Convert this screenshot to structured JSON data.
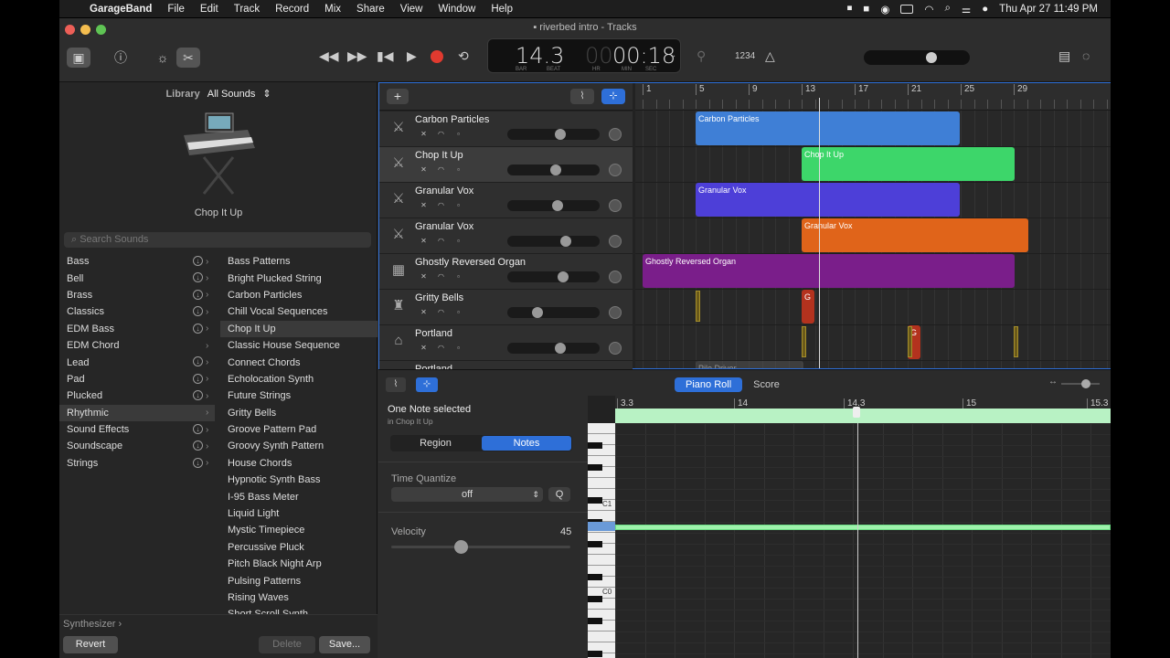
{
  "menubar": {
    "app": "GarageBand",
    "items": [
      "File",
      "Edit",
      "Track",
      "Record",
      "Mix",
      "Share",
      "View",
      "Window",
      "Help"
    ],
    "clock": "Thu Apr 27  11:49 PM"
  },
  "window": {
    "title": "riverbed intro - Tracks"
  },
  "lcd": {
    "bar_beat": "14.3",
    "bar_label": "BAR",
    "beat_label": "BEAT",
    "time_dim": "00",
    "time": "00:18",
    "hr_label": "HR",
    "min_label": "MIN",
    "sec_label": "SEC",
    "count_in": "1234"
  },
  "library": {
    "label": "Library",
    "dropdown": "All Sounds",
    "selected_patch": "Chop It Up",
    "search_placeholder": "Search Sounds",
    "categories": [
      {
        "label": "Bass",
        "download": true
      },
      {
        "label": "Bell",
        "download": true
      },
      {
        "label": "Brass",
        "download": true
      },
      {
        "label": "Classics",
        "download": true
      },
      {
        "label": "EDM Bass",
        "download": true
      },
      {
        "label": "EDM Chord",
        "download": false
      },
      {
        "label": "Lead",
        "download": true
      },
      {
        "label": "Pad",
        "download": true
      },
      {
        "label": "Plucked",
        "download": true
      },
      {
        "label": "Rhythmic",
        "download": false,
        "selected": true
      },
      {
        "label": "Sound Effects",
        "download": true
      },
      {
        "label": "Soundscape",
        "download": true
      },
      {
        "label": "Strings",
        "download": true
      }
    ],
    "sounds": [
      "Bass Patterns",
      "Bright Plucked String",
      "Carbon Particles",
      "Chill Vocal Sequences",
      "Chop It Up",
      "Classic House Sequence",
      "Connect Chords",
      "Echolocation Synth",
      "Future Strings",
      "Gritty Bells",
      "Groove Pattern Pad",
      "Groovy Synth Pattern",
      "House Chords",
      "Hypnotic Synth Bass",
      "I-95 Bass Meter",
      "Liquid Light",
      "Mystic Timepiece",
      "Percussive Pluck",
      "Pitch Black Night Arp",
      "Pulsing Patterns",
      "Rising Waves",
      "Short Scroll Synth"
    ],
    "selected_sound": "Chop It Up",
    "footer_path": "Synthesizer",
    "revert": "Revert",
    "delete": "Delete",
    "save": "Save..."
  },
  "tracks": {
    "add": "+",
    "ruler": [
      "1",
      "5",
      "9",
      "13",
      "17",
      "21",
      "25",
      "29"
    ],
    "list": [
      {
        "name": "Carbon Particles",
        "vol": 0.58,
        "selected": false
      },
      {
        "name": "Chop It Up",
        "vol": 0.53,
        "selected": true
      },
      {
        "name": "Granular Vox",
        "vol": 0.55,
        "selected": false
      },
      {
        "name": "Granular Vox",
        "vol": 0.65,
        "selected": false
      },
      {
        "name": "Ghostly Reversed Organ",
        "vol": 0.62,
        "selected": false
      },
      {
        "name": "Gritty Bells",
        "vol": 0.3,
        "selected": false
      },
      {
        "name": "Portland",
        "vol": 0.58,
        "selected": false
      },
      {
        "name": "Portland",
        "vol": 0.5,
        "selected": false
      }
    ],
    "regions": [
      {
        "name": "Carbon Particles",
        "color": "#3f7fd6"
      },
      {
        "name": "Chop It Up",
        "color": "#3dd66a"
      },
      {
        "name": "Granular Vox",
        "color": "#4d3fd8"
      },
      {
        "name": "Granular Vox",
        "color": "#e0641a"
      },
      {
        "name": "Ghostly Reversed Organ",
        "color": "#7a1e8a"
      },
      {
        "name": "G",
        "color": "#b3321e"
      },
      {
        "name": "G",
        "color": "#b3321e"
      },
      {
        "name": "Pile Driver",
        "color": "#555"
      }
    ]
  },
  "editor": {
    "status": "One Note selected",
    "status_sub": "in Chop It Up",
    "tab_region": "Region",
    "tab_notes": "Notes",
    "view_piano_roll": "Piano Roll",
    "view_score": "Score",
    "time_quantize_label": "Time Quantize",
    "time_quantize_value": "off",
    "q_button": "Q",
    "velocity_label": "Velocity",
    "velocity_value": "45",
    "ruler": [
      "3.3",
      "14",
      "14.3",
      "15",
      "15.3"
    ],
    "key_c1": "C1",
    "key_c0": "C0"
  },
  "colors": {
    "accent": "#2e6fd8",
    "record": "#e03a2f"
  }
}
